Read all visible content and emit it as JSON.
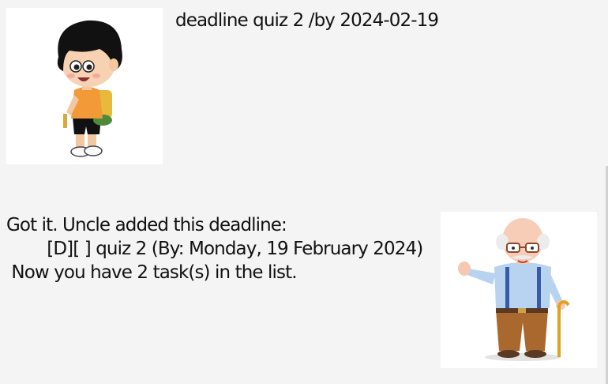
{
  "conversation": {
    "user_message": {
      "text": "deadline quiz 2 /by 2024-02-19",
      "avatar": "boy-with-backpack-avatar"
    },
    "bot_message": {
      "lines": [
        "Got it. Uncle added this deadline:",
        "        [D][ ] quiz 2 (By: Monday, 19 February 2024)",
        " Now you have 2 task(s) in the list."
      ],
      "avatar": "old-man-with-cane-avatar"
    }
  },
  "colors": {
    "background": "#f4f4f4",
    "avatar_bg": "#ffffff",
    "text": "#111111"
  }
}
